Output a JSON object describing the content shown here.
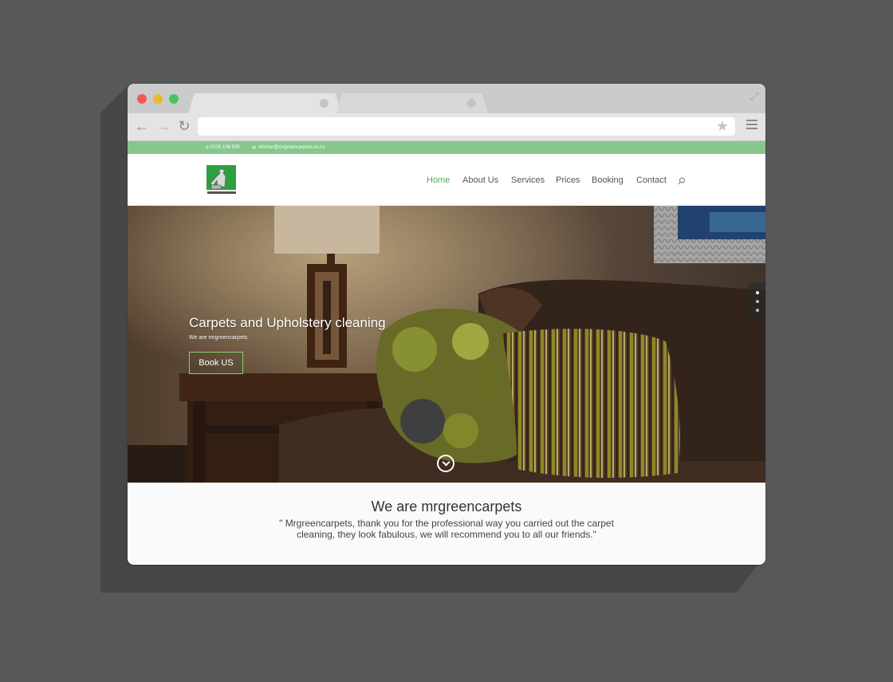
{
  "topbar": {
    "phone": "0226 106 535",
    "email": "shisher@mrgreencarpets.co.nz"
  },
  "nav": {
    "items": [
      "Home",
      "About Us",
      "Services",
      "Prices",
      "Booking",
      "Contact"
    ]
  },
  "hero": {
    "title": "Carpets and Upholstery cleaning",
    "subtitle": "We are mrgreencarpets",
    "button": "Book US"
  },
  "section": {
    "title": "We are mrgreencarpets",
    "quote": "\" Mrgreencarpets, thank you for the professional way you carried out the carpet cleaning, they look fabulous, we will recommend you to all our friends.\""
  },
  "colors": {
    "brand_green": "#4fb25a",
    "top_strip": "#86c78c",
    "button_border": "#8ccf6d"
  }
}
